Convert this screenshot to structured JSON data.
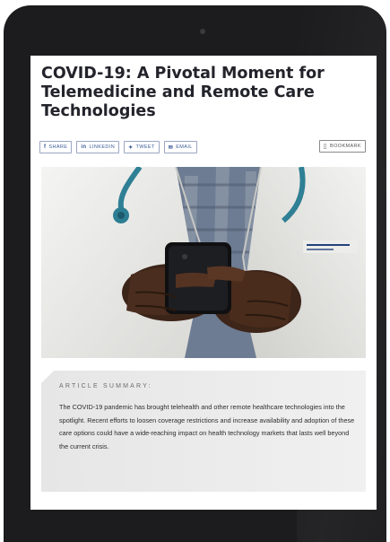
{
  "article": {
    "title": "COVID-19: A Pivotal Moment for Telemedicine and Remote Care Technologies"
  },
  "share": {
    "share_label": "SHARE",
    "linkedin_label": "LINKEDIN",
    "tweet_label": "TWEET",
    "email_label": "EMAIL",
    "bookmark_label": "BOOKMARK"
  },
  "summary": {
    "heading": "ARTICLE SUMMARY:",
    "body": "The COVID-19 pandemic has brought telehealth and other remote healthcare technologies into the spotlight. Recent efforts to loosen coverage restrictions and increase availability and adoption of these care options could have a wide-reaching impact on health technology markets that lasts well beyond the current crisis."
  },
  "colors": {
    "share_blue": "#3b5b98",
    "title_dark": "#23232b",
    "device_black": "#1c1c1e"
  }
}
